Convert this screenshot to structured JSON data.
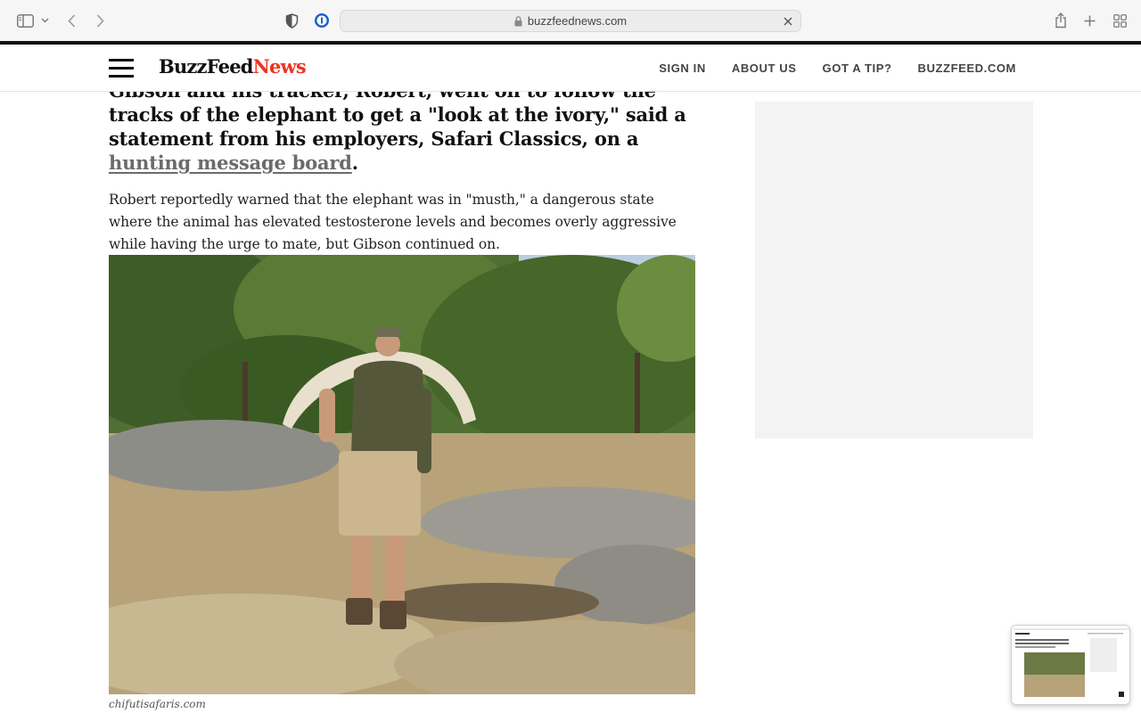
{
  "browser": {
    "url": "buzzfeednews.com",
    "icons": {
      "sidebar": "sidebar-icon",
      "dropdown": "chevron-down-icon",
      "back": "back-arrow-icon",
      "forward": "forward-arrow-icon",
      "privacy": "shield-icon",
      "extension": "password-manager-icon",
      "lock": "lock-icon",
      "clear": "close-icon",
      "share": "share-icon",
      "new_tab": "plus-icon",
      "tab_overview": "tab-grid-icon"
    }
  },
  "site": {
    "logo_buzz": "BuzzFeed",
    "logo_news": "News",
    "nav": [
      "SIGN IN",
      "ABOUT US",
      "GOT A TIP?",
      "BUZZFEED.COM"
    ],
    "accent_color": "#e32"
  },
  "article": {
    "lead_text": "Gibson and his tracker, Robert, went on to follow the tracks of the elephant to get a \"look at the ivory,\" said a statement from his employers, Safari Classics, on a ",
    "lead_link": "hunting message board",
    "lead_end": ".",
    "paragraph": "Robert reportedly warned that the elephant was in \"musth,\" a dangerous state where the animal has elevated testosterone levels and becomes overly aggressive while having the urge to mate, but Gibson continued on.",
    "photo_caption": "chifutisafaris.com"
  }
}
